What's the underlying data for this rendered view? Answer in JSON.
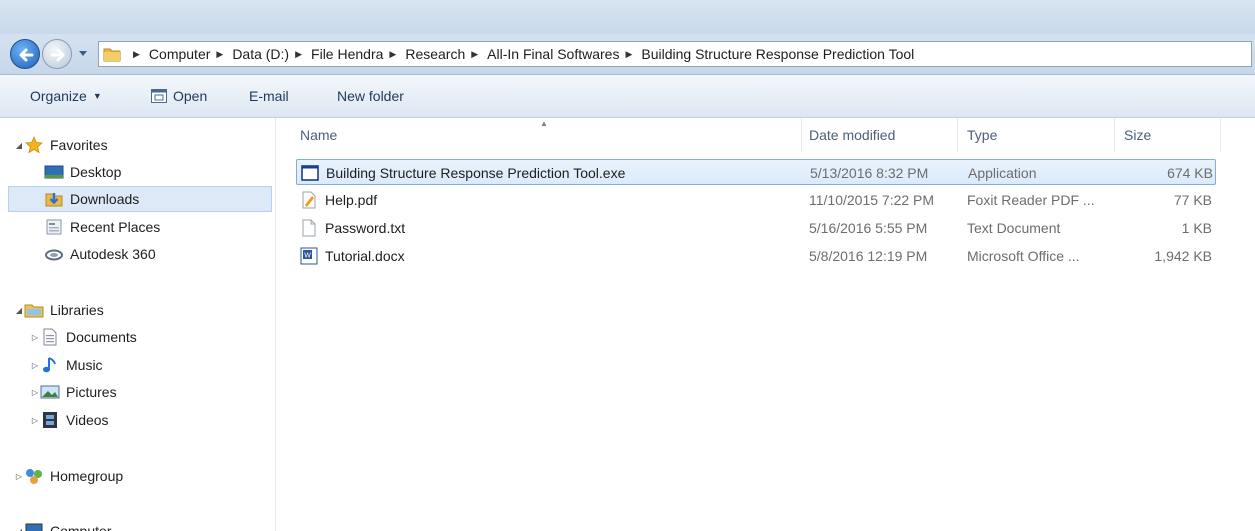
{
  "breadcrumb": [
    "Computer",
    "Data (D:)",
    "File Hendra",
    "Research",
    "All-In Final Softwares",
    "Building Structure Response Prediction Tool"
  ],
  "toolbar": {
    "organize": "Organize",
    "open": "Open",
    "email": "E-mail",
    "new_folder": "New folder"
  },
  "nav": {
    "favorites": "Favorites",
    "desktop": "Desktop",
    "downloads": "Downloads",
    "recent_places": "Recent Places",
    "autodesk": "Autodesk 360",
    "libraries": "Libraries",
    "documents": "Documents",
    "music": "Music",
    "pictures": "Pictures",
    "videos": "Videos",
    "homegroup": "Homegroup",
    "computer": "Computer"
  },
  "columns": {
    "name": "Name",
    "date": "Date modified",
    "type": "Type",
    "size": "Size"
  },
  "files": [
    {
      "name": "Building Structure Response Prediction Tool.exe",
      "date": "5/13/2016 8:32 PM",
      "type": "Application",
      "size": "674 KB",
      "icon": "application-icon",
      "selected": true
    },
    {
      "name": "Help.pdf",
      "date": "11/10/2015 7:22 PM",
      "type": "Foxit Reader PDF ...",
      "size": "77 KB",
      "icon": "pdf-icon",
      "selected": false
    },
    {
      "name": "Password.txt",
      "date": "5/16/2016 5:55 PM",
      "type": "Text Document",
      "size": "1 KB",
      "icon": "text-file-icon",
      "selected": false
    },
    {
      "name": "Tutorial.docx",
      "date": "5/8/2016 12:19 PM",
      "type": "Microsoft Office ...",
      "size": "1,942 KB",
      "icon": "word-doc-icon",
      "selected": false
    }
  ]
}
